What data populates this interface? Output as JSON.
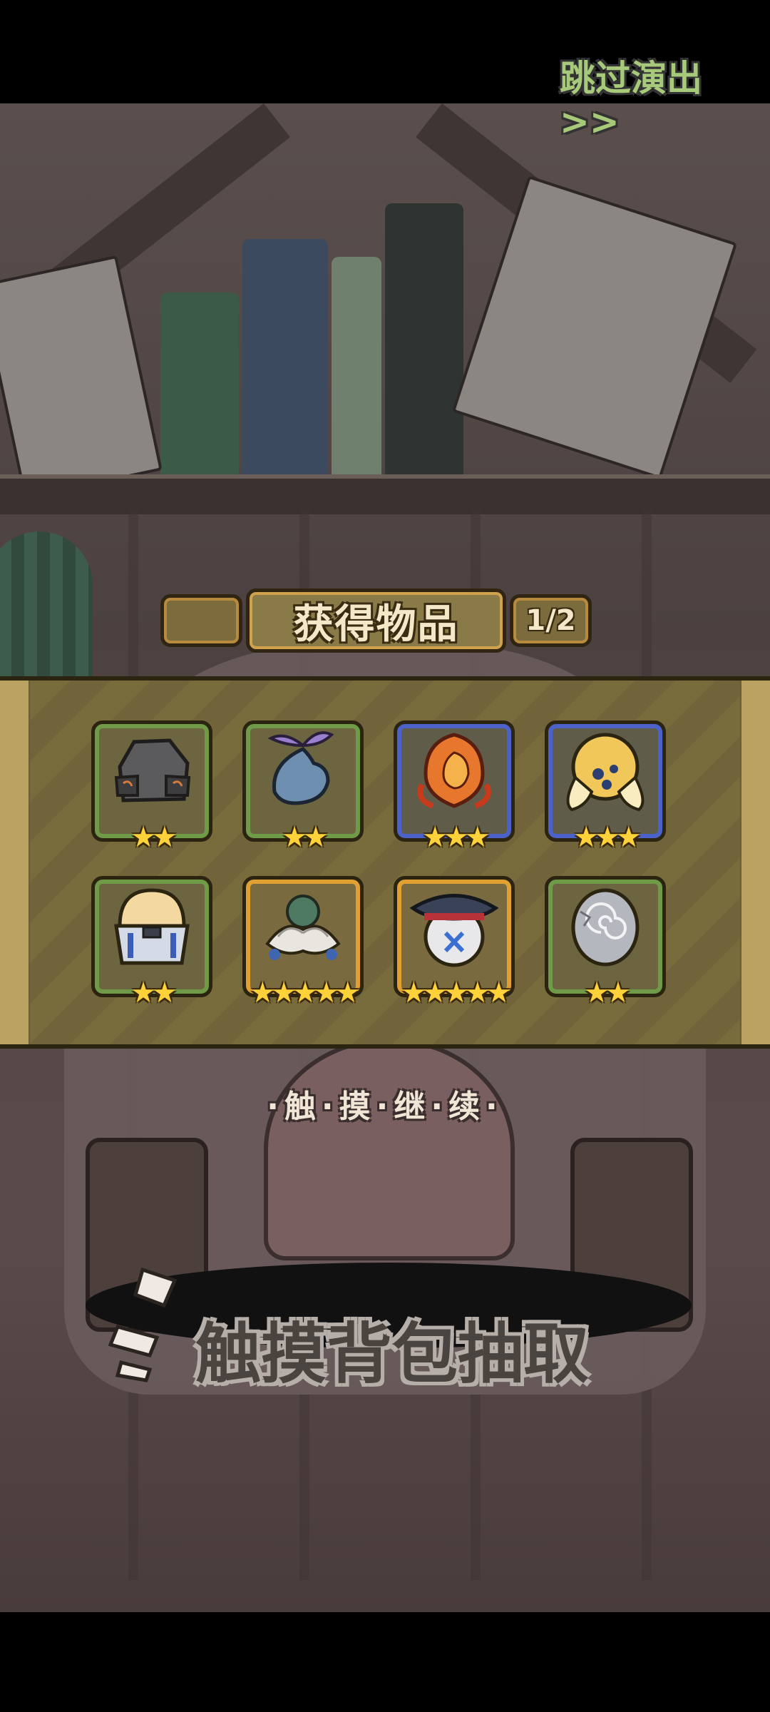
{
  "skip_button": {
    "label": "跳过演出>>"
  },
  "dialog": {
    "title": "获得物品",
    "page_indicator": "1/2"
  },
  "items": [
    {
      "name": "stone-helmet",
      "icon": "stone-helmet-icon",
      "frame_color": "#6f9a47",
      "stars": "★★"
    },
    {
      "name": "water-drop-sprout",
      "icon": "water-sprout-icon",
      "frame_color": "#6f9a47",
      "stars": "★★"
    },
    {
      "name": "fire-swirl",
      "icon": "fire-swirl-icon",
      "frame_color": "#4a62c9",
      "stars": "★★★"
    },
    {
      "name": "golden-jelly-orb",
      "icon": "jelly-orb-icon",
      "frame_color": "#4a62c9",
      "stars": "★★★"
    },
    {
      "name": "robot-dome",
      "icon": "robot-dome-icon",
      "frame_color": "#6f9a47",
      "stars": "★★"
    },
    {
      "name": "lotus-flower",
      "icon": "lotus-icon",
      "frame_color": "#e0a132",
      "stars": "★★★★★"
    },
    {
      "name": "captain-cap-orb",
      "icon": "captain-cap-icon",
      "frame_color": "#e0a132",
      "stars": "★★★★★"
    },
    {
      "name": "spiral-egg",
      "icon": "spiral-egg-icon",
      "frame_color": "#6f9a47",
      "stars": "★★"
    }
  ],
  "touch_continue": "·触·摸·继·续·",
  "draw_hint": "触摸背包抽取",
  "colors": {
    "common_frame": "#6f9a47",
    "rare_frame": "#4a62c9",
    "legendary_frame": "#e0a132",
    "star": "#ffd23a"
  }
}
